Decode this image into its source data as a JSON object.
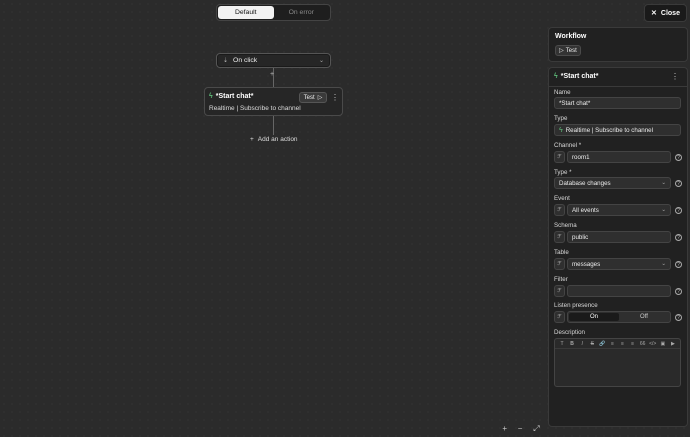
{
  "tabs": [
    {
      "label": "Default",
      "active": true
    },
    {
      "label": "On error",
      "active": false
    }
  ],
  "trigger": {
    "label": "On click"
  },
  "node": {
    "title": "*Start chat*",
    "subtitle": "Realtime | Subscribe to channel",
    "test_label": "Test"
  },
  "add_action_label": "Add an action",
  "close_label": "Close",
  "workflow": {
    "title": "Workflow",
    "test_label": "Test"
  },
  "editor": {
    "title": "*Start chat*",
    "fields": {
      "name": {
        "label": "Name",
        "value": "*Start chat*"
      },
      "type": {
        "label": "Type",
        "value": "Realtime | Subscribe to channel"
      },
      "channel": {
        "label": "Channel *",
        "value": "room1"
      },
      "type2": {
        "label": "Type *",
        "value": "Database changes"
      },
      "event": {
        "label": "Event",
        "value": "All events"
      },
      "schema": {
        "label": "Schema",
        "value": "public"
      },
      "table": {
        "label": "Table",
        "value": "messages"
      },
      "filter": {
        "label": "Filter",
        "value": ""
      },
      "presence": {
        "label": "Listen presence",
        "on": "On",
        "off": "Off"
      },
      "description": {
        "label": "Description",
        "value": ""
      }
    },
    "toolbar": [
      "T",
      "B",
      "I",
      "S",
      "🔗",
      "≡",
      "≡",
      "≡",
      "66",
      "</>",
      "▣",
      "▶"
    ]
  },
  "zoom": {
    "in": "+",
    "out": "−",
    "fit": "⤢"
  },
  "colors": {
    "accent": "#5fbf7a",
    "background": "#2b2b2b"
  }
}
